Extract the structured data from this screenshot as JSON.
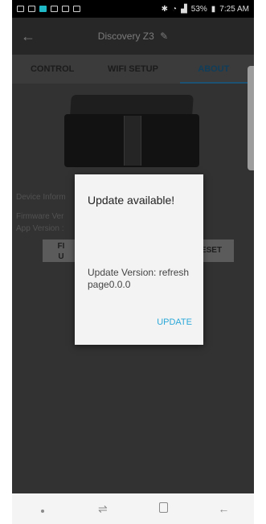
{
  "status_bar": {
    "battery": "53%",
    "time": "7:25 AM"
  },
  "app_bar": {
    "title": "Discovery Z3"
  },
  "tabs": [
    {
      "label": "CONTROL",
      "active": false
    },
    {
      "label": "WIFI SETUP",
      "active": false
    },
    {
      "label": "ABOUT",
      "active": true
    }
  ],
  "content": {
    "device_info_label": "Device Inform",
    "firmware_label": "Firmware Ver",
    "app_version_label": "App Version :",
    "left_button_label": "FI\nU",
    "right_button_label": "ESET"
  },
  "dialog": {
    "title": "Update available!",
    "message": "Update Version: refresh page0.0.0",
    "button": "UPDATE"
  },
  "nav_bar": {
    "back": "←"
  },
  "colors": {
    "accent": "#2aa8d8",
    "tab_indicator": "#2d7fb3",
    "dialog_bg": "#f3f3f3"
  }
}
